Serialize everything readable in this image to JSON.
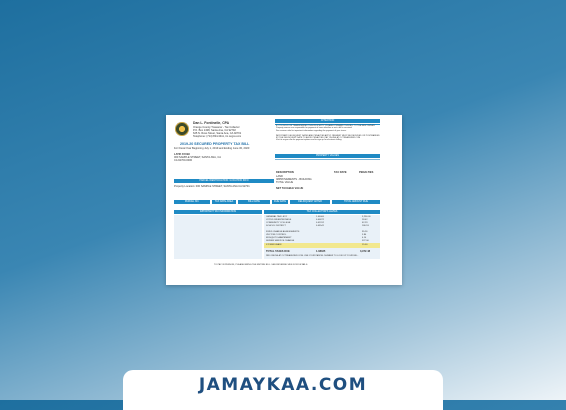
{
  "document": {
    "name": "Dan L. Fontinelle, CPA",
    "office_line": "Orange County Treasurer - Tax Collector",
    "addr1": "P.O. Box 1438, Santa Ana, CA 92702",
    "addr2": "625 N. Ross Street, Santa Ana, CA 92701",
    "addr3": "Telephone: (714) 834-3411, ttc.ocgov.com",
    "bill_title": "2019-20 SECURED PROPERTY TAX BILL",
    "period": "For Fiscal Year Beginning July 1, 2019 and Ending June 30, 2020",
    "owner_label": "LATIF AYUBI",
    "owner_addr1": "000 SAMPLE STREET, SANTA ANA, CA",
    "owner_addr2": "CA 92700-0000",
    "attention_header": "ATTENTION",
    "attention_text": [
      "IF YOU SOLD OR TRANSFERRED THIS PROPERTY, PLEASE FORWARD THIS BILL TO THE NEW OWNER.",
      "Property owners are responsible for payment of taxes whether or not a bill is received.",
      "See reverse side for important information regarding the payment of your taxes.",
      "",
      "IMPORTANT: DELINQUENT DATES AND PENALTIES APPLY. PAYMENT MUST BE RECEIVED OR POSTMARKED",
      "BY THE DELINQUENT DATE TO AVOID PENALTIES. PAY ONLINE AT OCTREASURER.COM",
      "Visit ttc.ocgov.com for payment options and to sign up for electronic billing."
    ],
    "property_header": "PROPERTY VALUES",
    "property_labels": [
      "DESCRIPTION",
      "TAX RATE",
      "PENALTIES"
    ],
    "property_rows": [
      "LAND",
      "IMPROVEMENTS - BUILDING",
      "TOTAL VALUE",
      "",
      "NET TAXABLE VALUE"
    ],
    "location_header": "PARCEL IDENTIFICATION / LOCATION INFO",
    "location_text": "Property Location: 000 SAMPLE STREET, SANTA ANA CA 92701",
    "strip_labels": [
      "PARCEL NO.",
      "TAX RATE AREA",
      "BILL DATE",
      "DUE DATE",
      "DELINQUENT AFTER",
      "TOTAL AMOUNT DUE"
    ],
    "agencies_header": "IMPORTANT TAX INFORMATION",
    "levy_header": "TAX COLLECTOR'S LEVIES",
    "levy_rows": [
      [
        "GENERAL TAX LEVY",
        "1.00000",
        "3,256.00"
      ],
      [
        "VOTED INDEBTEDNESS",
        "0.00872",
        "28.42"
      ],
      [
        "COMMUNITY COLLEGE",
        "0.01912",
        "62.29"
      ],
      [
        "SCHOOL DISTRICT",
        "0.05541",
        "180.53"
      ],
      [
        "",
        "",
        ""
      ],
      [
        "FIXED CHARGE ASSESSMENTS",
        "",
        "95.26"
      ],
      [
        "VECTOR CONTROL",
        "",
        "3.84"
      ],
      [
        "MOSQUITO ABATEMENT",
        "",
        "4.14"
      ],
      [
        "SEWER SERVICE CHARGE",
        "",
        "327.00"
      ],
      [
        "STORM DRAIN",
        "",
        "15.00"
      ]
    ],
    "total_label": "TOTAL TAXES DUE",
    "total_rate": "1.08325",
    "total_amount": "3,972.48",
    "pay_note": "PAY ONLINE AT OCTREASURER.COM. USE YOUR PARCEL NUMBER TO LOOK UP YOUR BILL.",
    "bottom_note": "TO PAY IN PERSON, PLEASE BRING THE ENTIRE BILL. SEE REVERSE SIDE FOR DETAILS."
  },
  "footer": {
    "brand": "JAMAYKAA.COM"
  },
  "colors": {
    "accent": "#1f8ac4",
    "brand_text": "#1f4f80",
    "highlight": "#f2e88e"
  }
}
